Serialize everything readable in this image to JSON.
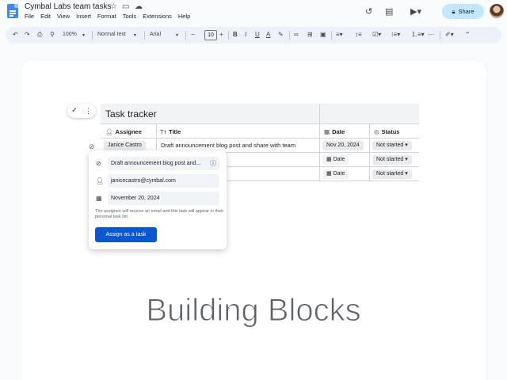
{
  "app": {
    "doc_title": "Cymbal Labs team tasks",
    "menus": [
      "File",
      "Edit",
      "View",
      "Insert",
      "Format",
      "Tools",
      "Extensions",
      "Help"
    ],
    "share_label": "Share"
  },
  "toolbar": {
    "zoom": "100%",
    "style": "Normal text",
    "font": "Arial",
    "font_size": "10"
  },
  "table": {
    "title": "Task tracker",
    "headers": [
      "Assignee",
      "Title",
      "Date",
      "Status"
    ],
    "rows": [
      {
        "assignee": "Janice Castro",
        "title": "Draft announcement blog post and share with team",
        "date": "Nov 20, 2024",
        "status": "Not started"
      },
      {
        "assignee": "",
        "title": "",
        "date": "Date",
        "status": "Not started"
      },
      {
        "assignee": "",
        "title": "",
        "date": "Date",
        "status": "Not started"
      }
    ]
  },
  "popup": {
    "task_field": "Draft announcement blog post and...",
    "email_field": "janicecastro@cymbal.com",
    "date_field": "November 20, 2024",
    "note": "The assignee will receive an email and this task will appear in their personal task list",
    "assign_button": "Assign as a task"
  },
  "caption": "Building Blocks",
  "colors": {
    "accent": "#0b57d0",
    "share_bg": "#c2e7ff",
    "toolbar_bg": "#edf2fa",
    "doc_icon": "#4285f4"
  },
  "icons": [
    "docs-logo-icon",
    "star-icon",
    "folder-move-icon",
    "cloud-status-icon",
    "history-icon",
    "comment-icon",
    "meet-video-icon",
    "lock-icon",
    "undo-icon",
    "redo-icon",
    "print-icon",
    "paint-format-icon",
    "bold-icon",
    "italic-icon",
    "underline-icon",
    "text-color-icon",
    "highlight-icon",
    "link-icon",
    "insert-comment-icon",
    "image-icon",
    "align-icon",
    "line-spacing-icon",
    "checklist-icon",
    "bulleted-list-icon",
    "numbered-list-icon",
    "more-icon",
    "edit-mode-icon",
    "collapse-icon",
    "checkbox-icon",
    "person-icon",
    "calendar-icon",
    "help-icon"
  ]
}
